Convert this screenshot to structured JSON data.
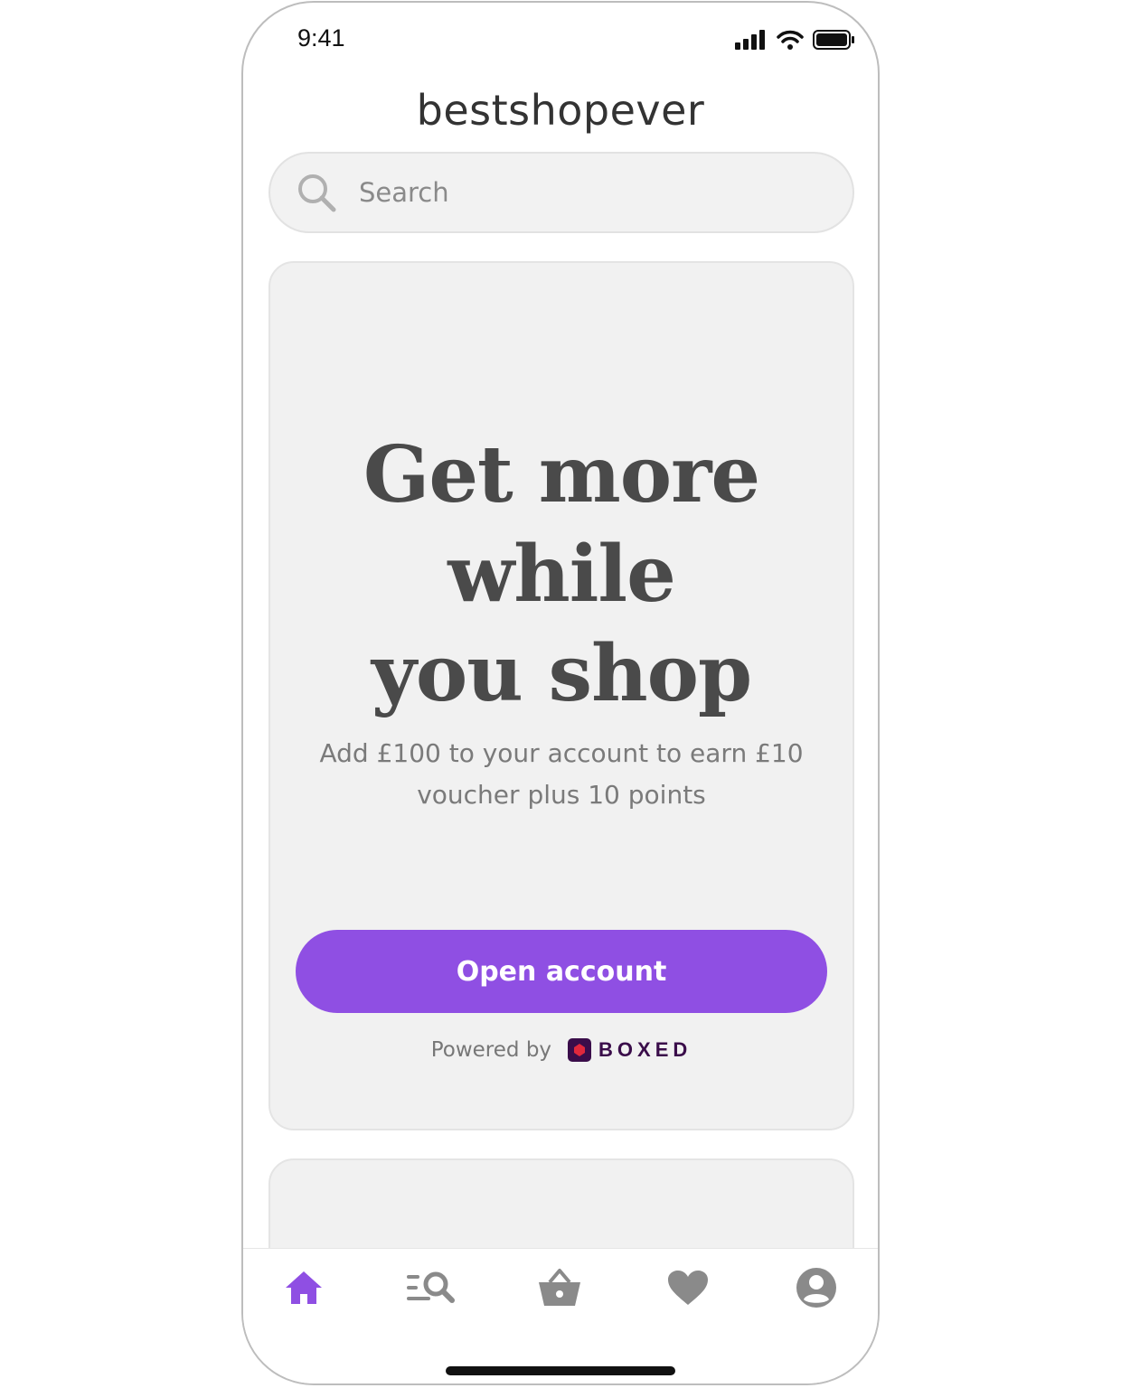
{
  "status_bar": {
    "time": "9:41"
  },
  "header": {
    "logo_text": "bestshopever"
  },
  "search": {
    "placeholder": "Search"
  },
  "promo": {
    "headline_lines": [
      "Get more",
      "while",
      "you shop"
    ],
    "subtext": "Add £100 to your account to earn £10 voucher plus 10 points",
    "cta_label": "Open account",
    "powered_by_label": "Powered by",
    "partner_name": "BOXED"
  },
  "tabbar": {
    "tabs": [
      {
        "icon": "home-icon",
        "active": true
      },
      {
        "icon": "browse-search-icon",
        "active": false
      },
      {
        "icon": "basket-icon",
        "active": false
      },
      {
        "icon": "heart-icon",
        "active": false
      },
      {
        "icon": "account-icon",
        "active": false
      }
    ]
  },
  "colors": {
    "accent": "#8f4fe3",
    "icon_inactive": "#8a8a8a",
    "headline": "#4a4a4a",
    "boxed_brand": "#3a0d4a"
  }
}
